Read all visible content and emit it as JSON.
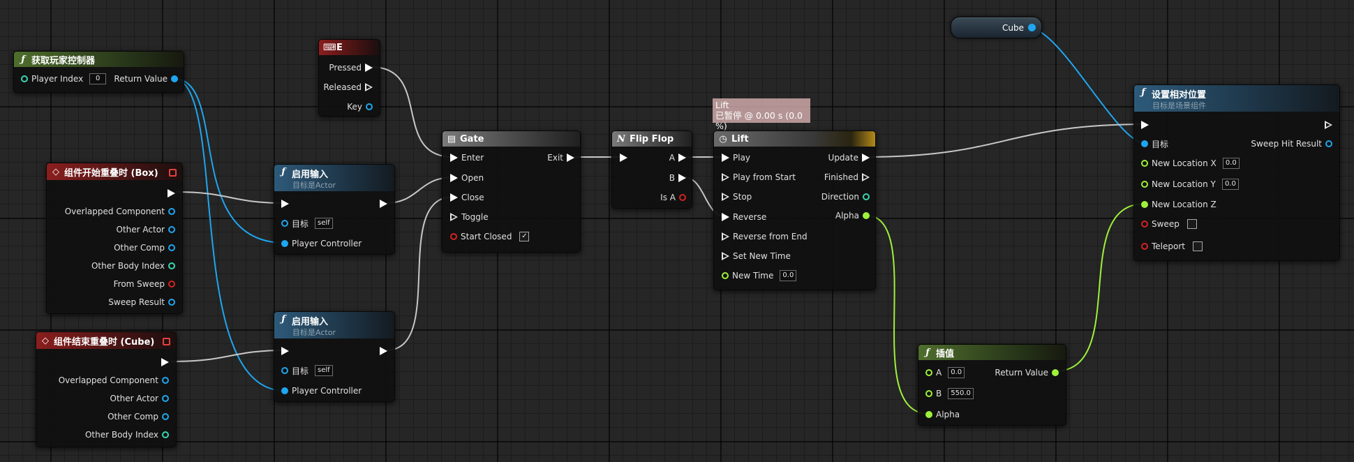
{
  "nodes": {
    "get_player_controller": {
      "title": "获取玩家控制器",
      "icon": "ƒ",
      "player_index_label": "Player Index",
      "player_index_value": "0",
      "return_value_label": "Return Value"
    },
    "input_e": {
      "title": "E",
      "pressed": "Pressed",
      "released": "Released",
      "key": "Key"
    },
    "begin_overlap": {
      "title": "组件开始重叠时 (Box)",
      "pins": [
        "Overlapped Component",
        "Other Actor",
        "Other Comp",
        "Other Body Index",
        "From Sweep",
        "Sweep Result"
      ]
    },
    "end_overlap": {
      "title": "组件结束重叠时 (Cube)",
      "pins": [
        "Overlapped Component",
        "Other Actor",
        "Other Comp",
        "Other Body Index"
      ]
    },
    "enable_input_1": {
      "title": "启用输入",
      "subtitle": "目标是Actor",
      "target_label": "目标",
      "target_value": "self",
      "player_controller_label": "Player Controller"
    },
    "enable_input_2": {
      "title": "启用输入",
      "subtitle": "目标是Actor",
      "target_label": "目标",
      "target_value": "self",
      "player_controller_label": "Player Controller"
    },
    "gate": {
      "title": "Gate",
      "enter": "Enter",
      "exit": "Exit",
      "open": "Open",
      "close": "Close",
      "toggle": "Toggle",
      "start_closed": "Start Closed",
      "start_closed_checked": true
    },
    "flip_flop": {
      "title": "Flip Flop",
      "a": "A",
      "b": "B",
      "is_a": "Is A"
    },
    "lift": {
      "title": "Lift",
      "comment_title": "Lift",
      "comment_status": "已暂停 @ 0.00 s (0.0 %)",
      "inputs": [
        "Play",
        "Play from Start",
        "Stop",
        "Reverse",
        "Reverse from End",
        "Set New Time"
      ],
      "new_time_label": "New Time",
      "new_time_value": "0.0",
      "update": "Update",
      "finished": "Finished",
      "direction": "Direction",
      "alpha": "Alpha"
    },
    "cube_var": {
      "label": "Cube"
    },
    "set_relative_location": {
      "title": "设置相对位置",
      "subtitle": "目标是场景组件",
      "target_label": "目标",
      "sweep_hit_result": "Sweep Hit Result",
      "loc_x_label": "New Location X",
      "loc_x_value": "0.0",
      "loc_y_label": "New Location Y",
      "loc_y_value": "0.0",
      "loc_z_label": "New Location Z",
      "sweep_label": "Sweep",
      "sweep_checked": false,
      "teleport_label": "Teleport",
      "teleport_checked": false
    },
    "lerp": {
      "title": "插值",
      "a_label": "A",
      "a_value": "0.0",
      "b_label": "B",
      "b_value": "550.0",
      "alpha_label": "Alpha",
      "return_value_label": "Return Value"
    }
  },
  "colors": {
    "object_pin": "#1fa6f0",
    "float_pin": "#9ef23b",
    "int_pin": "#3ad6b0",
    "bool_pin": "#d62222",
    "exec_pin": "#ffffff",
    "wire_exec": "#c8c8c8",
    "header_function": "#2d5a7a",
    "header_pure": "#4f6e2d",
    "header_event": "#8b1e1e",
    "header_macro": "#7a7a7a"
  }
}
